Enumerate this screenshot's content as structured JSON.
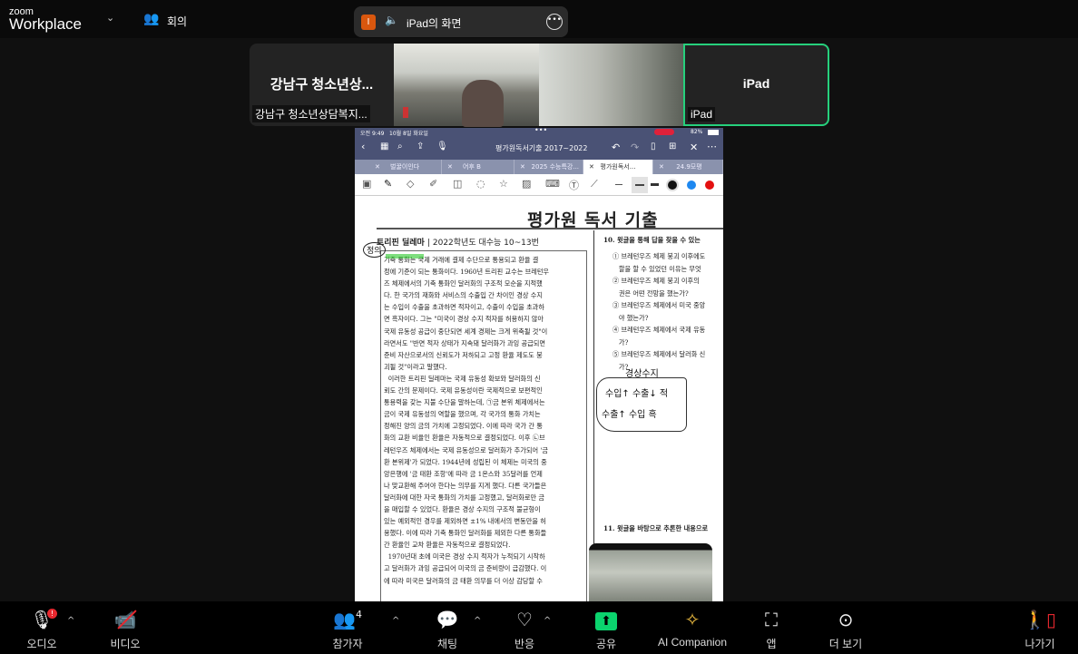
{
  "header": {
    "logo_small": "zoom",
    "logo_big": "Workplace",
    "meeting_label": "회의"
  },
  "share_pill": {
    "badge": "I",
    "title": "iPad의 화면"
  },
  "thumbnails": [
    {
      "big_name": "강남구 청소년상...",
      "name": "강남구 청소년상담복지..."
    },
    {
      "name": ""
    },
    {
      "name": ""
    },
    {
      "big_name": "iPad",
      "name": "iPad"
    }
  ],
  "ipad": {
    "status": {
      "time": "오전 9:49",
      "date": "10월 8일 화요일",
      "battery": "82%"
    },
    "doc_name": "평가원독서기출 2017~2022",
    "tabs": [
      "벌꿀이인다",
      "어후 B",
      "2025 수능특강...",
      "평가원독서...",
      "24.9모평"
    ],
    "active_tab": 3,
    "colors": {
      "nav": "#4a5275",
      "black": "#111111",
      "blue": "#1e88f0",
      "red": "#e31010"
    }
  },
  "document": {
    "title": "평가원 독서 기출",
    "section_title": "트리핀 딜레마",
    "section_source": "2022학년도 대수능 10~13번",
    "passage_lines": [
      "기축 통화는 국제 거래에 결제 수단으로 통용되고 환율 결",
      "정에 기준이 되는 통화이다. 1960년 트리핀 교수는 브레턴우",
      "즈 체제에서의 기축 통화인 달러화의 구조적 모순을 지적했",
      "다. 한 국가의 재화와 서비스의 수출입 간 차이인 경상 수지",
      "는 수입이 수출을 초과하면 적자이고, 수출이 수입을 초과하",
      "면 흑자이다. 그는 \"미국이 경상 수지 적자를 허용하지 않아",
      "국제 유동성 공급이 중단되면 세계 경제는 크게 위축될 것\"이",
      "라면서도 \"반면 적자 상태가 지속돼 달러화가 과잉 공급되면",
      "준비 자산으로서의 신뢰도가 저하되고 고정 환율 제도도 붕",
      "괴될 것\"이라고 말했다.",
      "  이러한 트리핀 딜레마는 국제 유동성 확보와 달러화의 신",
      "뢰도 간의 문제이다. 국제 유동성이란 국제적으로 보편적인",
      "통용력을 갖는 지불 수단을 말하는데, ㉠금 본위 체제에서는",
      "금이 국제 유동성의 역할을 했으며, 각 국가의 통화 가치는",
      "정해진 양의 금의 가치에 고정되었다. 이에 따라 국가 간 통",
      "화의 교환 비율인 환율은 자동적으로 결정되었다. 이후 ㉡브",
      "레턴우즈 체제에서는 국제 유동성으로 달러화가 추가되어 '금",
      "환 본위제'가 되었다. 1944년에 성립된 이 체제는 미국의 중",
      "앙은행에 '금 태환 조항'에 따라 금 1온스와 35달러를 언제",
      "나 맞교환해 주어야 한다는 의무를 지게 했다. 다른 국가들은",
      "달러화에 대한 자국 통화의 가치를 고정했고, 달러화로만 금",
      "을 매입할 수 있었다. 환율은 경상 수지의 구조적 불균형이",
      "있는 예외적인 경우를 제외하면 ±1% 내에서의 변동만을 허",
      "용했다. 이에 따라 기축 통화인 달러화를 제외한 다른 통화들",
      "간 환율인 교차 환율은 자동적으로 결정되었다.",
      "  1970년대 초에 미국은 경상 수지 적자가 누적되기 시작하",
      "고 달러화가 과잉 공급되어 미국의 금 준비량이 급감했다. 이",
      "에 따라 미국은 달러화의 금 태환 의무를 더 이상 감당할 수"
    ],
    "q10": {
      "stem": "10. 윗글을 통해 답을 찾을 수 있는",
      "choices": [
        "① 브레턴우즈 체제 붕괴 이후에도",
        "   할을 할 수 있었던 이유는 무엇",
        "② 브레턴우즈 체제 붕괴 이후의",
        "   권은 어떤 전망을 했는가?",
        "③ 브레턴우즈 체제에서 미국 중앙",
        "   야 했는가?",
        "④ 브레턴우즈 체제에서 국제 유동",
        "   가?",
        "⑤ 브레턴우즈 체제에서 달러화 신",
        "   가?"
      ]
    },
    "q11": {
      "stem": "11. 윗글을 바탕으로 추론한 내용으로"
    },
    "handwriting": {
      "note_top": "경상수지",
      "note_line1": "수입↑ 수출↓ 적",
      "note_line2": "수출↑ 수입 흑",
      "margin": "정의"
    }
  },
  "toolbar": {
    "items": [
      {
        "label": "오디오",
        "icon": "microphone-icon",
        "badge": "!"
      },
      {
        "label": "비디오",
        "icon": "video-off-icon"
      },
      {
        "label": "참가자",
        "icon": "participants-icon",
        "count": "4"
      },
      {
        "label": "채팅",
        "icon": "chat-icon"
      },
      {
        "label": "반응",
        "icon": "heart-icon"
      },
      {
        "label": "공유",
        "icon": "share-icon"
      },
      {
        "label": "AI Companion",
        "icon": "sparkle-icon"
      },
      {
        "label": "앱",
        "icon": "apps-icon"
      },
      {
        "label": "더 보기",
        "icon": "more-icon"
      },
      {
        "label": "나가기",
        "icon": "leave-icon"
      }
    ],
    "colors": {
      "share": "#0bd46e",
      "ai": "#f5c242",
      "leave": "#e8282f"
    }
  }
}
